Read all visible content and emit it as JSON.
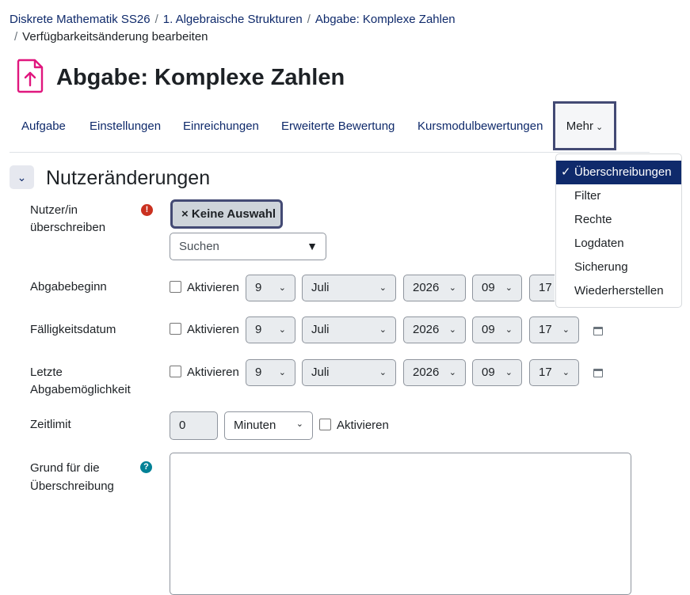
{
  "breadcrumb": {
    "items": [
      "Diskrete Mathematik SS26",
      "1. Algebraische Strukturen",
      "Abgabe: Komplexe Zahlen"
    ],
    "current": "Verfügbarkeitsänderung bearbeiten",
    "separator": "/"
  },
  "page": {
    "title": "Abgabe: Komplexe Zahlen",
    "icon": "assignment-upload-icon",
    "accent": "#e0177e"
  },
  "nav": {
    "tabs": [
      "Aufgabe",
      "Einstellungen",
      "Einreichungen",
      "Erweiterte Bewertung",
      "Kursmodulbewertungen"
    ],
    "more": "Mehr"
  },
  "dropdown": {
    "items": [
      "Überschreibungen",
      "Filter",
      "Rechte",
      "Logdaten",
      "Sicherung",
      "Wiederherstellen"
    ],
    "active": "Überschreibungen"
  },
  "section": {
    "title": "Nutzeränderungen"
  },
  "form": {
    "user_label_1": "Nutzer/in",
    "user_label_2": "überschreiben",
    "chip": "× Keine Auswahl",
    "search_placeholder": "Suchen",
    "activate": "Aktivieren",
    "start_label": "Abgabebeginn",
    "due_label": "Fälligkeitsdatum",
    "cutoff_label_1": "Letzte",
    "cutoff_label_2": "Abgabemöglichkeit",
    "day": "9",
    "month": "Juli",
    "year": "2026",
    "hour": "09",
    "minute": "17",
    "timelimit_label": "Zeitlimit",
    "timelimit_value": "0",
    "timelimit_unit": "Minuten",
    "reason_label_1": "Grund für die",
    "reason_label_2": "Überschreibung"
  },
  "colors": {
    "link": "#0f2a6b",
    "required": "#ca3120",
    "help": "#008196",
    "focus": "#434a74"
  }
}
